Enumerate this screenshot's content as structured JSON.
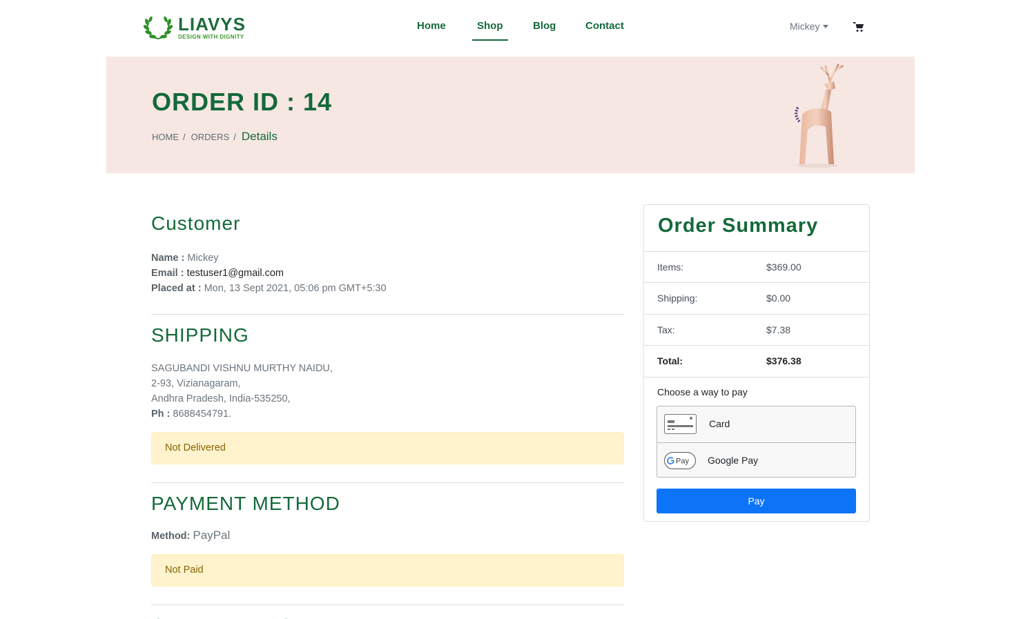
{
  "brand": {
    "name": "LIAVYS",
    "tagline": "DESIGN WITH DIGNITY",
    "colors": {
      "primary": "#14693a",
      "accent": "#3b9a2b",
      "banner_bg": "#f6e7e3",
      "button": "#0d74f8",
      "alert_bg": "#fff3cd"
    }
  },
  "nav": {
    "links": [
      {
        "label": "Home",
        "active": false
      },
      {
        "label": "Shop",
        "active": true
      },
      {
        "label": "Blog",
        "active": false
      },
      {
        "label": "Contact",
        "active": false
      }
    ],
    "user": "Mickey",
    "cart_icon": "shopping-cart-icon"
  },
  "banner": {
    "title": "ORDER ID : 14",
    "breadcrumb": [
      "HOME",
      "ORDERS",
      "Details"
    ],
    "image_icon": "deer-figurine-image"
  },
  "customer": {
    "heading": "Customer",
    "name_label": "Name :",
    "name": "Mickey",
    "email_label": "Email :",
    "email": "testuser1@gmail.com",
    "placed_label": "Placed at :",
    "placed_at": "Mon, 13 Sept 2021, 05:06 pm GMT+5:30"
  },
  "shipping": {
    "heading": "SHIPPING",
    "address_lines": [
      "SAGUBANDI VISHNU MURTHY NAIDU,",
      "2-93, Vizianagaram,",
      "Andhra Pradesh, India-535250,"
    ],
    "phone_label": "Ph :",
    "phone": "8688454791.",
    "status": "Not Delivered"
  },
  "payment": {
    "heading": "PAYMENT METHOD",
    "method_label": "Method:",
    "method": "PayPal",
    "status": "Not Paid"
  },
  "order_items": {
    "heading": "ORDER ITEMS"
  },
  "summary": {
    "title": "Order Summary",
    "rows": [
      {
        "label": "Items:",
        "value": "$369.00"
      },
      {
        "label": "Shipping:",
        "value": "$0.00"
      },
      {
        "label": "Tax:",
        "value": "$7.38"
      },
      {
        "label": "Total:",
        "value": "$376.38"
      }
    ],
    "pay_prompt": "Choose a way to pay",
    "options": [
      {
        "label": "Card",
        "icon": "credit-card-icon"
      },
      {
        "label": "Google Pay",
        "icon": "google-pay-icon"
      }
    ],
    "pay_button": "Pay"
  }
}
